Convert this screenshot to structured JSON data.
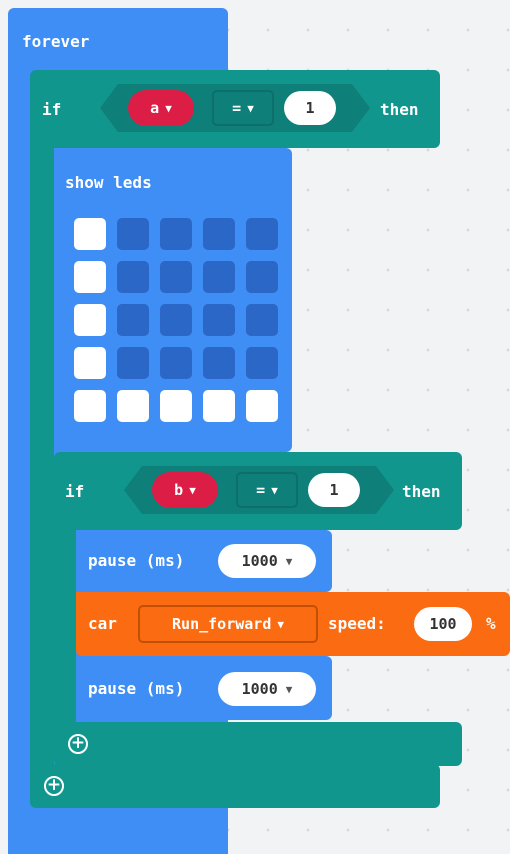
{
  "forever": {
    "label": "forever"
  },
  "if_outer": {
    "label": "if",
    "var": "a",
    "operator": "=",
    "value": "1",
    "then": "then"
  },
  "show_leds": {
    "label": "show leds",
    "grid": [
      [
        1,
        0,
        0,
        0,
        0
      ],
      [
        1,
        0,
        0,
        0,
        0
      ],
      [
        1,
        0,
        0,
        0,
        0
      ],
      [
        1,
        0,
        0,
        0,
        0
      ],
      [
        1,
        1,
        1,
        1,
        1
      ]
    ]
  },
  "if_inner": {
    "label": "if",
    "var": "b",
    "operator": "=",
    "value": "1",
    "then": "then"
  },
  "pause1": {
    "label": "pause (ms)",
    "value": "1000"
  },
  "car": {
    "label": "car",
    "direction": "Run_forward",
    "speed_label": "speed:",
    "speed": "100",
    "unit": "%"
  },
  "pause2": {
    "label": "pause (ms)",
    "value": "1000"
  },
  "colors": {
    "blue": "#3f8ef5",
    "teal": "#11968e",
    "orange": "#fb6b12",
    "variable": "#dc1e47"
  }
}
